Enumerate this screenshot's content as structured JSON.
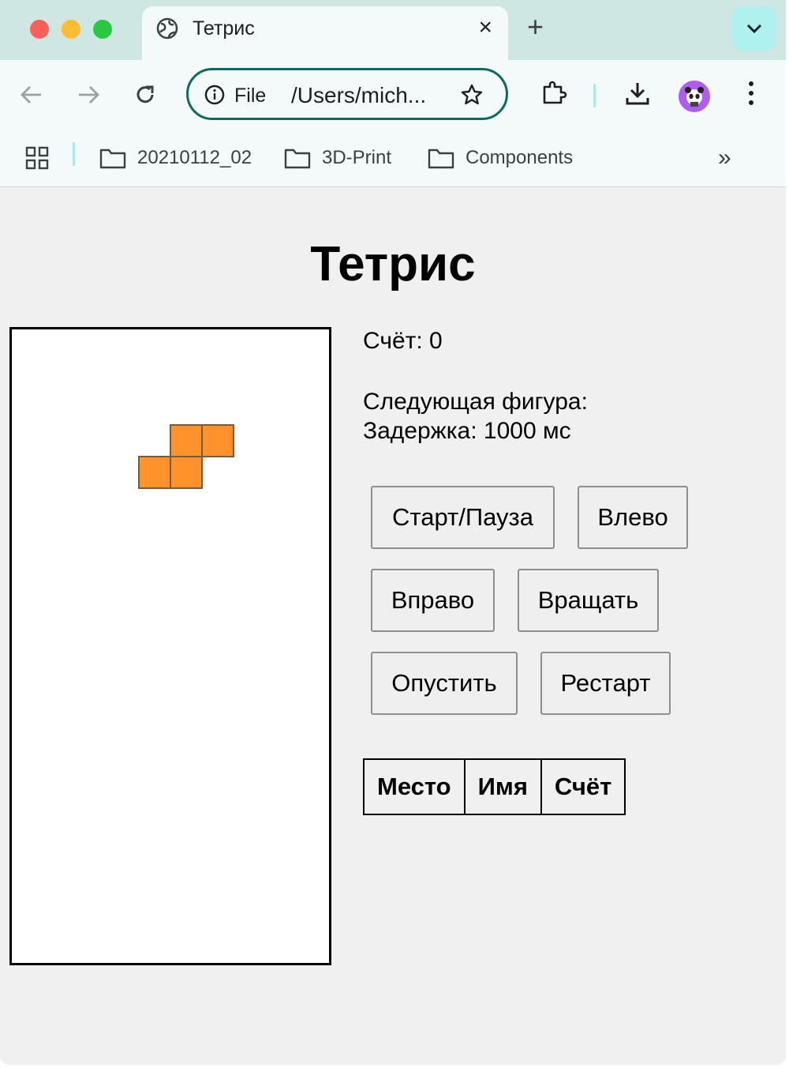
{
  "browser": {
    "tab_title": "Тетрис",
    "close_glyph": "×",
    "new_tab_glyph": "+",
    "scheme_label": "File",
    "url": "/Users/mich...",
    "bookmarks": [
      {
        "label": "20210112_02"
      },
      {
        "label": "3D-Print"
      },
      {
        "label": "Components"
      }
    ],
    "more_glyph": "»",
    "accent_color": "#0b6b63"
  },
  "game": {
    "title": "Тетрис",
    "score_line": "Счёт: 0",
    "next_piece_line": "Следующая фигура:",
    "delay_line": "Задержка: 1000 мс",
    "piece_color": "#ff922b",
    "current_piece": {
      "shape": "S"
    },
    "buttons": {
      "start_pause": "Старт/Пауза",
      "left": "Влево",
      "right": "Вправо",
      "rotate": "Вращать",
      "drop": "Опустить",
      "restart": "Рестарт"
    },
    "leaderboard": {
      "headers": [
        "Место",
        "Имя",
        "Счёт"
      ]
    }
  }
}
